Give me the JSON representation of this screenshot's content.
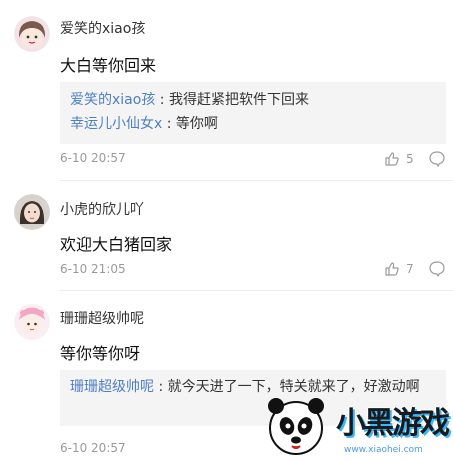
{
  "comments": [
    {
      "user": "爱笑的xiao孩",
      "text": "大白等你回来",
      "replies": [
        {
          "user": "爱笑的xiao孩",
          "text": "我得赶紧把软件下回来"
        },
        {
          "user": "幸运儿小仙女x",
          "text": "等你啊"
        }
      ],
      "time": "6-10 20:57",
      "likes": "5"
    },
    {
      "user": "小虎的欣儿吖",
      "text": "欢迎大白猪回家",
      "time": "6-10 21:05",
      "likes": "7"
    },
    {
      "user": "珊珊超级帅呢",
      "text": "等你等你呀",
      "replies": [
        {
          "user": "珊珊超级帅呢",
          "text": "就今天进了一下，特关就来了，好激动啊"
        }
      ],
      "time": "6-10 20:57"
    }
  ],
  "separator": " : ",
  "watermark": {
    "logo_text": "小黑游戏",
    "url": "www.xiaohei.com"
  },
  "colors": {
    "link": "#4e7fc4",
    "meta": "#9a9a9a",
    "reply_bg": "#f4f4f5"
  },
  "icons": [
    "avatar-cartoon-girl",
    "avatar-girl-photo",
    "avatar-pink-hat-girl",
    "thumbs-up-icon",
    "comment-bubble-icon",
    "panda-logo"
  ]
}
